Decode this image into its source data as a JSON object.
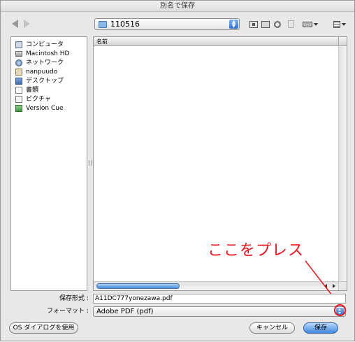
{
  "window": {
    "title": "別名で保存"
  },
  "toolbar": {
    "path": "110516",
    "icons": [
      "back-arrow-icon",
      "forward-arrow-icon",
      "new-folder-icon",
      "desktop-icon",
      "refresh-icon",
      "trash-icon",
      "drive-icon",
      "list-view-icon"
    ]
  },
  "sidebar": {
    "items": [
      {
        "label": "コンピュータ",
        "icon": "computer-icon"
      },
      {
        "label": "Macintosh HD",
        "icon": "hard-drive-icon"
      },
      {
        "label": "ネットワーク",
        "icon": "network-icon"
      },
      {
        "label": "nanpuudo",
        "icon": "home-icon"
      },
      {
        "label": "デスクトップ",
        "icon": "desktop-icon"
      },
      {
        "label": "書類",
        "icon": "documents-icon"
      },
      {
        "label": "ピクチャ",
        "icon": "pictures-icon"
      },
      {
        "label": "Version Cue",
        "icon": "version-cue-icon"
      }
    ]
  },
  "browser": {
    "column_header": "名前"
  },
  "annotation": {
    "text": "ここをプレス",
    "color": "#e8141b"
  },
  "form": {
    "filename_label": "保存形式 :",
    "filename_value": "A11DC777yonezawa.pdf",
    "format_label": "フォーマット :",
    "format_value": "Adobe PDF  (pdf)"
  },
  "buttons": {
    "os_dialog": "OS ダイアログを使用",
    "cancel": "キャンセル",
    "save": "保存"
  }
}
